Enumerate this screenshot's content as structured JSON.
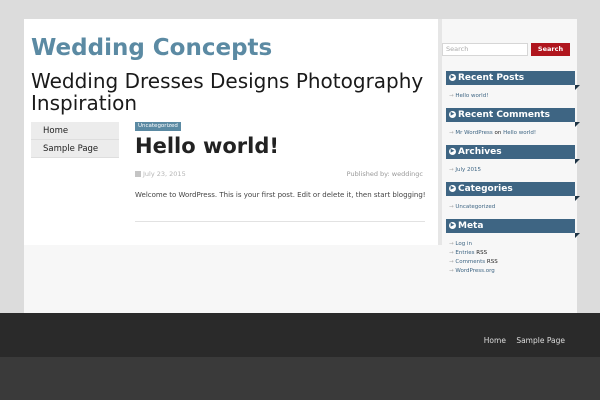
{
  "site": {
    "title": "Wedding Concepts",
    "description": "Wedding Dresses Designs Photography Inspiration"
  },
  "menu": [
    {
      "label": "Home"
    },
    {
      "label": "Sample Page"
    }
  ],
  "post": {
    "category": "Uncategorized",
    "title": "Hello world!",
    "date": "July 23, 2015",
    "author_prefix": "Published by:",
    "author": "weddingc",
    "body": "Welcome to WordPress. This is your first post. Edit or delete it, then start blogging!"
  },
  "search": {
    "placeholder": "Search",
    "button_label": "Search"
  },
  "widgets": {
    "recent_posts": {
      "title": "Recent Posts",
      "items": [
        "Hello world!"
      ]
    },
    "recent_comments": {
      "title": "Recent Comments",
      "commenter": "Mr WordPress",
      "on": "on",
      "post": "Hello world!"
    },
    "archives": {
      "title": "Archives",
      "items": [
        "July 2015"
      ]
    },
    "categories": {
      "title": "Categories",
      "items": [
        "Uncategorized"
      ]
    },
    "meta": {
      "title": "Meta",
      "items": [
        "Log in",
        "Entries",
        "Comments",
        "WordPress.org"
      ],
      "rss": "RSS"
    }
  },
  "footer": {
    "nav": [
      "Home",
      "Sample Page"
    ]
  },
  "colors": {
    "title": "#5b8aa3",
    "widget_header": "#3e6583",
    "search_button": "#b0161e",
    "footer": "#2a2a2a"
  }
}
